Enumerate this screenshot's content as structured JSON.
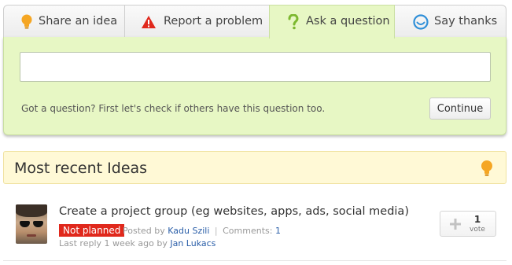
{
  "tabs": [
    {
      "label": "Share an idea",
      "icon": "lightbulb-icon"
    },
    {
      "label": "Report a problem",
      "icon": "warning-icon"
    },
    {
      "label": "Ask a question",
      "icon": "question-icon"
    },
    {
      "label": "Say thanks",
      "icon": "smiley-icon"
    }
  ],
  "active_tab": 2,
  "question_panel": {
    "input_value": "",
    "hint": "Got a question? First let's check if others have this question too.",
    "continue_label": "Continue"
  },
  "recent": {
    "title": "Most recent Ideas",
    "icon": "lightbulb-icon"
  },
  "idea": {
    "title": "Create a project group (eg websites, apps, ads, social media)",
    "status": "Not planned",
    "posted_by_prefix": "Posted by",
    "author": "Kadu Szili",
    "comments_label": "Comments:",
    "comments_count": "1",
    "last_reply_prefix": "Last reply 1 week ago by",
    "last_reply_author": "Jan Lukacs",
    "votes": "1",
    "vote_label": "vote"
  },
  "colors": {
    "panel_bg": "#e7f7c4",
    "recent_bg": "#fff9d6",
    "status_red": "#e0281c",
    "link": "#2a5ea8",
    "bulb": "#f5a623",
    "question_green": "#7cb82f",
    "smiley_blue": "#2f8fd8"
  }
}
